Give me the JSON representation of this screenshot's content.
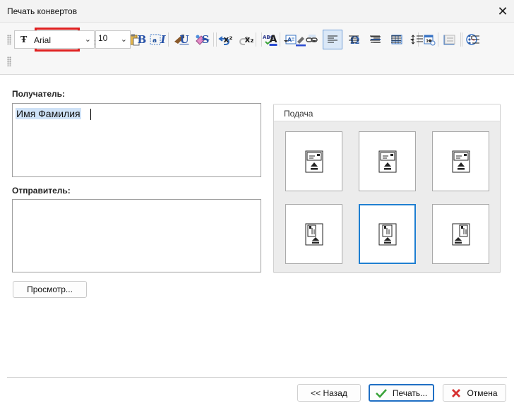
{
  "window": {
    "title": "Печать конвертов",
    "close_glyph": "✕"
  },
  "toolbar": {
    "row1_icons": [
      "save-icon",
      "table-grid-icon",
      "table-list-icon",
      "cut-icon",
      "copy-icon",
      "paste-icon",
      "select-all-icon",
      "format-painter-icon",
      "eraser-icon",
      "undo-icon",
      "redo-icon",
      "spell-check-icon",
      "text-box-icon",
      "link-icon",
      "image-icon",
      "omega-symbol-icon",
      "horizontal-line-icon",
      "table-icon",
      "insert-date-icon",
      "insert-calendar-icon",
      "clock-icon"
    ],
    "font_name": "Arial",
    "font_size": "10",
    "bold": "B",
    "italic": "I",
    "underline": "U",
    "strike": "S",
    "superscript": "x²",
    "subscript": "x₂",
    "font_color_letter": "A"
  },
  "form": {
    "recipient_label": "Получатель:",
    "recipient_value": "Имя  Фамилия",
    "sender_label": "Отправитель:",
    "sender_value": "",
    "preview_button": "Просмотр..."
  },
  "feed": {
    "title": "Подача",
    "selected_option": 5
  },
  "footer": {
    "back_button": "<<  Назад",
    "print_button": "Печать...",
    "cancel_button": "Отмена"
  }
}
